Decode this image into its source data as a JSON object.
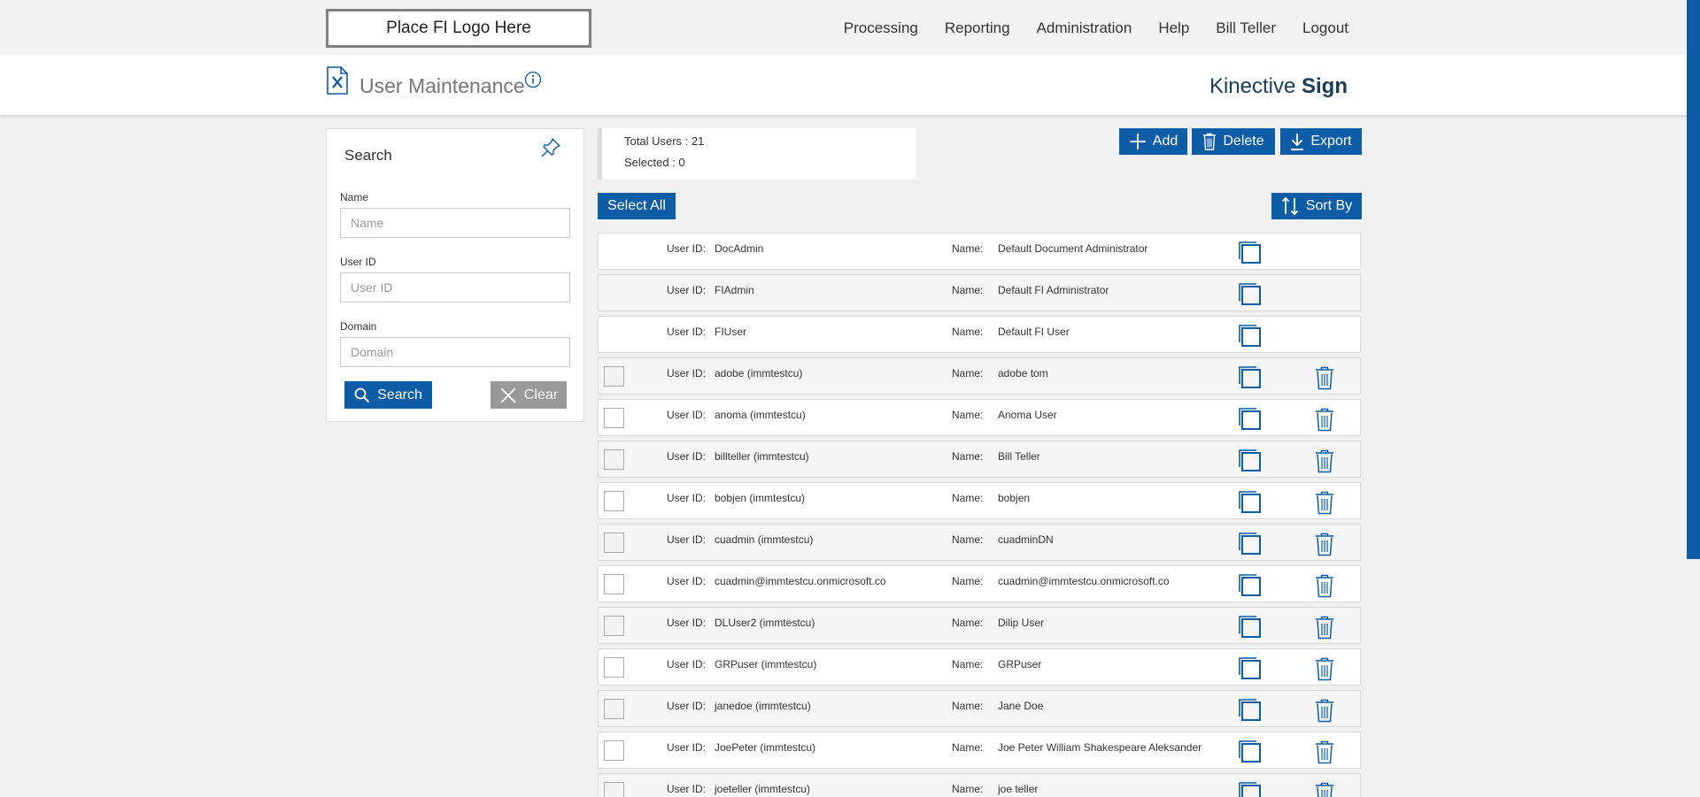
{
  "header": {
    "logo_text": "Place FI Logo Here",
    "nav": [
      "Processing",
      "Reporting",
      "Administration",
      "Help",
      "Bill Teller",
      "Logout"
    ]
  },
  "title_band": {
    "page_title": "User Maintenance",
    "brand_light": "Kinective ",
    "brand_bold": "Sign"
  },
  "search": {
    "title": "Search",
    "name_label": "Name",
    "name_placeholder": "Name",
    "userid_label": "User ID",
    "userid_placeholder": "User ID",
    "domain_label": "Domain",
    "domain_placeholder": "Domain",
    "search_button": "Search",
    "clear_button": "Clear"
  },
  "summary": {
    "total": "Total Users : 21",
    "selected": "Selected : 0"
  },
  "actions": {
    "add": "Add",
    "delete": "Delete",
    "export": "Export",
    "select_all": "Select All",
    "sort_by": "Sort By"
  },
  "list_labels": {
    "user_id": "User ID:",
    "name": "Name:"
  },
  "users": [
    {
      "user_id": "DocAdmin",
      "name": "Default Document Administrator",
      "deletable": false
    },
    {
      "user_id": "FIAdmin",
      "name": "Default FI Administrator",
      "deletable": false
    },
    {
      "user_id": "FIUser",
      "name": "Default FI User",
      "deletable": false
    },
    {
      "user_id": "adobe (immtestcu)",
      "name": "adobe tom",
      "deletable": true
    },
    {
      "user_id": "anoma (immtestcu)",
      "name": "Anoma User",
      "deletable": true
    },
    {
      "user_id": "billteller (immtestcu)",
      "name": "Bill Teller",
      "deletable": true
    },
    {
      "user_id": "bobjen (immtestcu)",
      "name": "bobjen",
      "deletable": true
    },
    {
      "user_id": "cuadmin (immtestcu)",
      "name": "cuadminDN",
      "deletable": true
    },
    {
      "user_id": "cuadmin@immtestcu.onmicrosoft.co",
      "name": "cuadmin@immtestcu.onmicrosoft.co",
      "deletable": true
    },
    {
      "user_id": "DLUser2 (immtestcu)",
      "name": "Dilip User",
      "deletable": true
    },
    {
      "user_id": "GRPuser (immtestcu)",
      "name": "GRPuser",
      "deletable": true
    },
    {
      "user_id": "janedoe (immtestcu)",
      "name": "Jane Doe",
      "deletable": true
    },
    {
      "user_id": "JoePeter (immtestcu)",
      "name": "Joe Peter William Shakespeare Aleksander",
      "deletable": true
    },
    {
      "user_id": "joeteller (immtestcu)",
      "name": "joe teller",
      "deletable": true
    }
  ],
  "colors": {
    "primary": "#0d5da6",
    "clear_button": "#999999"
  }
}
